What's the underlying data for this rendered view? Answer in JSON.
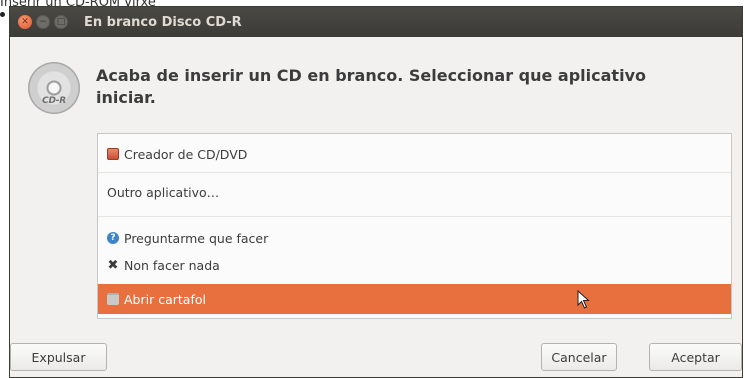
{
  "page": {
    "caption": "Inserir un CD-ROM virxe"
  },
  "window": {
    "title": "En branco Disco CD-R",
    "controls": [
      "close-icon",
      "minimize-icon",
      "maximize-icon"
    ]
  },
  "dialog": {
    "icon_label": "CD-R",
    "message": "Acaba de inserir un CD en branco. Seleccionar que aplicativo iniciar."
  },
  "app_list": {
    "items": [
      {
        "label": "Creador de CD/DVD",
        "icon": "cd-creator-icon"
      },
      {
        "label": "Outro aplicativo…",
        "icon": ""
      },
      {
        "label": "Preguntarme que facer",
        "icon": "question-icon"
      },
      {
        "label": "Non facer nada",
        "icon": "x-icon"
      },
      {
        "label": "Abrir cartafol",
        "icon": "folder-icon",
        "selected": true
      }
    ]
  },
  "buttons": {
    "eject": "Expulsar",
    "cancel": "Cancelar",
    "accept": "Aceptar"
  },
  "colors": {
    "selection": "#e8703f",
    "titlebar": "#3c3b37",
    "close_button": "#e0542c"
  }
}
